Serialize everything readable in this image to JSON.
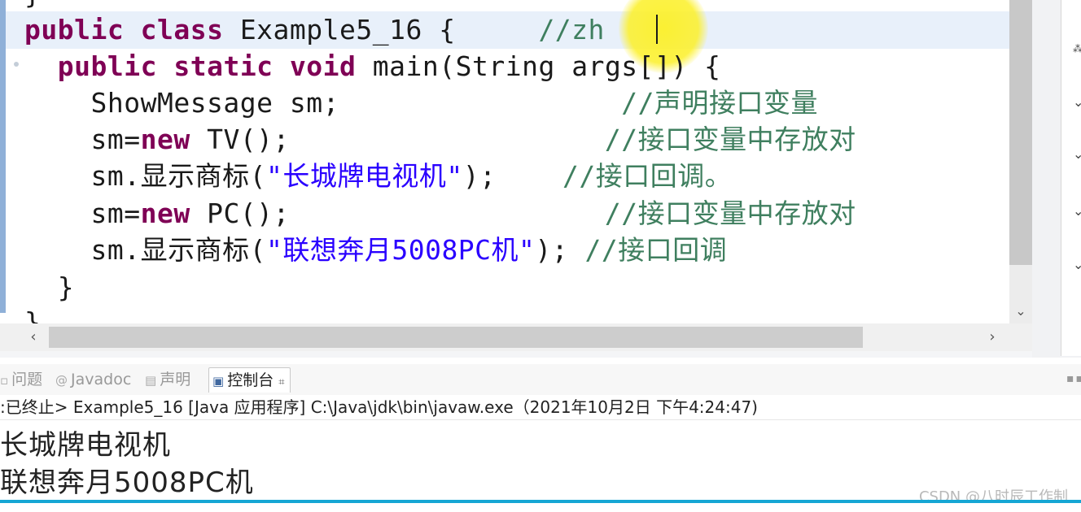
{
  "editor": {
    "brace_top": "}",
    "line1": {
      "kw1": "public",
      "kw2": "class",
      "name": "Example5_16 {",
      "comment": "//zh"
    },
    "line2": {
      "kw1": "public",
      "kw2": "static",
      "kw3": "void",
      "rest": "main(String args[]) {"
    },
    "line3": {
      "code": "ShowMessage sm;",
      "comment": "//声明接口变量"
    },
    "line4": {
      "pre": "sm=",
      "kw": "new",
      "post": " TV();",
      "comment": "//接口变量中存放对"
    },
    "line5": {
      "pre": "sm.显示商标(",
      "str": "\"长城牌电视机\"",
      "post": ");",
      "comment": "//接口回调。"
    },
    "line6": {
      "pre": "sm=",
      "kw": "new",
      "post": " PC();",
      "comment": "//接口变量中存放对"
    },
    "line7": {
      "pre": "sm.显示商标(",
      "str": "\"联想奔月5008PC机\"",
      "post": "); ",
      "comment": "//接口回调"
    },
    "line8": "}",
    "line9": "}"
  },
  "scrollbars": {
    "left_arrow": "‹",
    "right_arrow": "›",
    "down_arrow": "⌄"
  },
  "console": {
    "tabs": [
      {
        "label": "问题",
        "icon": "problems-icon"
      },
      {
        "label": "Javadoc",
        "icon": "javadoc-icon"
      },
      {
        "label": "声明",
        "icon": "declaration-icon"
      },
      {
        "label": "控制台",
        "icon": "console-icon"
      }
    ],
    "close_glyph": "⌗",
    "status": ":已终止> Example5_16 [Java 应用程序] C:\\Java\\jdk\\bin\\javaw.exe（2021年10月2日 下午4:24:47)",
    "output": [
      "长城牌电视机",
      "联想奔月5008PC机"
    ]
  },
  "watermark": "CSDN @八时辰工作制",
  "colors": {
    "keyword": "#7f0055",
    "string": "#2a00ff",
    "comment": "#3f7f5f",
    "accent": "#15a6d4",
    "cursor_highlight": "#fcf028"
  }
}
